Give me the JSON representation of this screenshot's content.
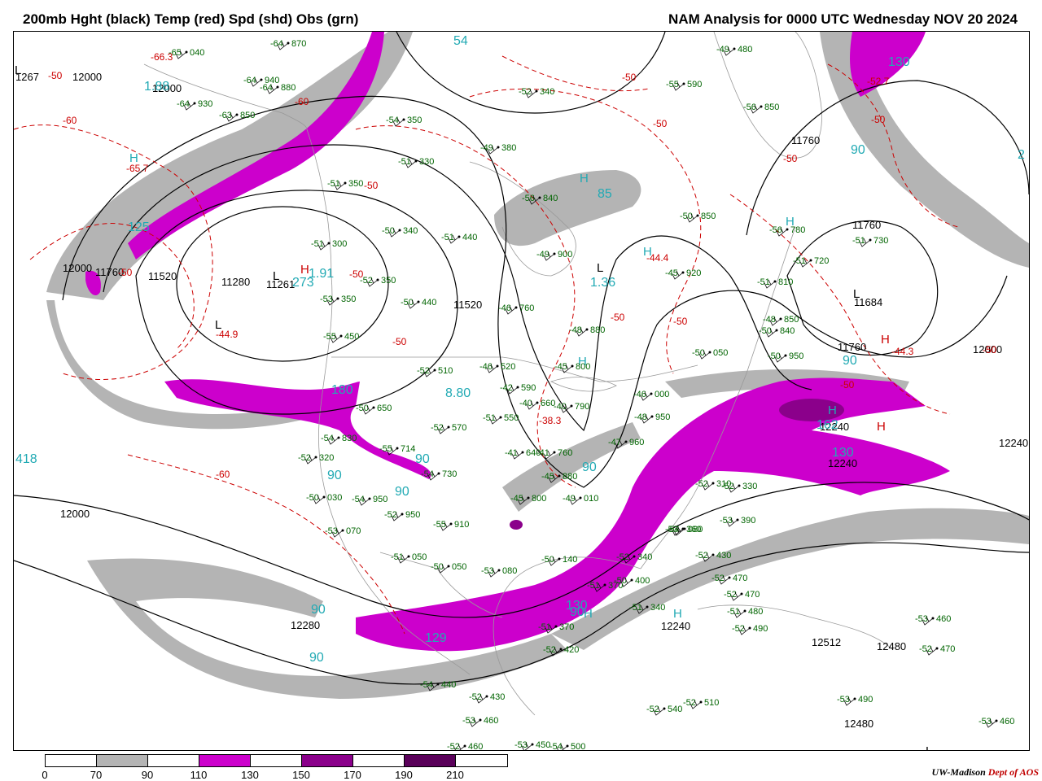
{
  "title": {
    "left": "200mb Hght (black) Temp (red) Spd (shd) Obs (grn)",
    "right": "NAM Analysis for 0000 UTC Wednesday  NOV 20 2024"
  },
  "colors": {
    "shade_70_90": "#b4b4b4",
    "shade_110_130": "#cc00cc",
    "shade_150_170": "#8b008b",
    "shade_190_210": "#5a005a",
    "height_contour": "#000000",
    "temp_contour": "#cc0000",
    "obs": "#006400",
    "speed_label": "#22aab4",
    "geography": "#999999"
  },
  "legend": {
    "ticks": [
      "0",
      "70",
      "90",
      "110",
      "130",
      "150",
      "170",
      "190",
      "210"
    ],
    "cells": [
      "#ffffff",
      "#b4b4b4",
      "#ffffff",
      "#cc00cc",
      "#ffffff",
      "#8b008b",
      "#ffffff",
      "#5a005a",
      "#ffffff"
    ]
  },
  "credit": {
    "org": "UW-Madison",
    "dept": "Dept of AOS"
  },
  "height_labels": [
    "1267",
    "12000",
    "12000",
    "12000",
    "11760",
    "11520",
    "11280",
    "11261",
    "11520",
    "11760",
    "11760",
    "11760",
    "11684",
    "12000",
    "12000",
    "12240",
    "12240",
    "12240",
    "12240",
    "12512",
    "12480",
    "12480",
    "12280"
  ],
  "temp_labels": [
    "-66.3",
    "-50",
    "-65.7",
    "-50",
    "-44.9",
    "-50",
    "-60",
    "-50",
    "-50",
    "-44.4",
    "-50",
    "-50",
    "-50",
    "-44.3",
    "-50",
    "-50",
    "-38.3",
    "-50",
    "-60",
    "-52.7",
    "-50",
    "-60",
    "-50"
  ],
  "speed_labels": [
    "1.88",
    "54",
    "85",
    "1.36",
    "130",
    "90",
    "2",
    "125",
    "273",
    "1.91",
    "8.80",
    "180",
    "90",
    "90",
    "90",
    "162",
    "130",
    "90",
    "418",
    "90",
    "129",
    "90",
    "90",
    "130",
    "90"
  ],
  "extrema": [
    "L",
    "H",
    "L",
    "H",
    "L",
    "H",
    "L",
    "H",
    "H",
    "H",
    "L",
    "H",
    "H",
    "H",
    "H",
    "L",
    "H"
  ],
  "obs": [
    "-65 040",
    "-64 870",
    "-64 940",
    "-64 930",
    "-63 850",
    "-64 880",
    "-54 350",
    "-52 340",
    "-51 330",
    "-51 350",
    "-49 380",
    "-56 840",
    "-55 590",
    "-56 850",
    "-49 480",
    "-50 850",
    "-56 780",
    "-51 730",
    "-51 720",
    "-45 920",
    "-51 810",
    "-48 850",
    "-50 340",
    "-51 300",
    "-51 440",
    "-49 900",
    "-52 350",
    "-53 350",
    "-50 440",
    "-46 760",
    "-48 880",
    "-55 450",
    "-52 510",
    "-45 800",
    "-46 520",
    "-42 590",
    "-50 050",
    "-50 950",
    "-50 840",
    "-50 650",
    "-40 660",
    "-40 790",
    "-46 000",
    "-51 550",
    "-52 570",
    "-41 640",
    "-41 760",
    "-47 960",
    "-48 950",
    "-54 830",
    "-52 320",
    "-55 714",
    "-54 730",
    "-45 880",
    "-50 030",
    "-54 950",
    "-52 950",
    "-45 800",
    "-49 010",
    "-53 070",
    "-55 910",
    "-51 050",
    "-50 050",
    "-53 080",
    "-52 340",
    "-52 310",
    "-52 330",
    "-53 390",
    "-54 080",
    "-51 340",
    "-53 360",
    "-52 430",
    "-52 470",
    "-52 470",
    "-51 480",
    "-52 490",
    "-53 460",
    "-52 470",
    "-50 140",
    "-51 370",
    "-50 400",
    "-51 370",
    "-52 420",
    "-54 440",
    "-52 430",
    "-53 460",
    "-52 540",
    "-52 510",
    "-53 490",
    "-52 460",
    "-53 450",
    "-54 500",
    "-53 460"
  ]
}
